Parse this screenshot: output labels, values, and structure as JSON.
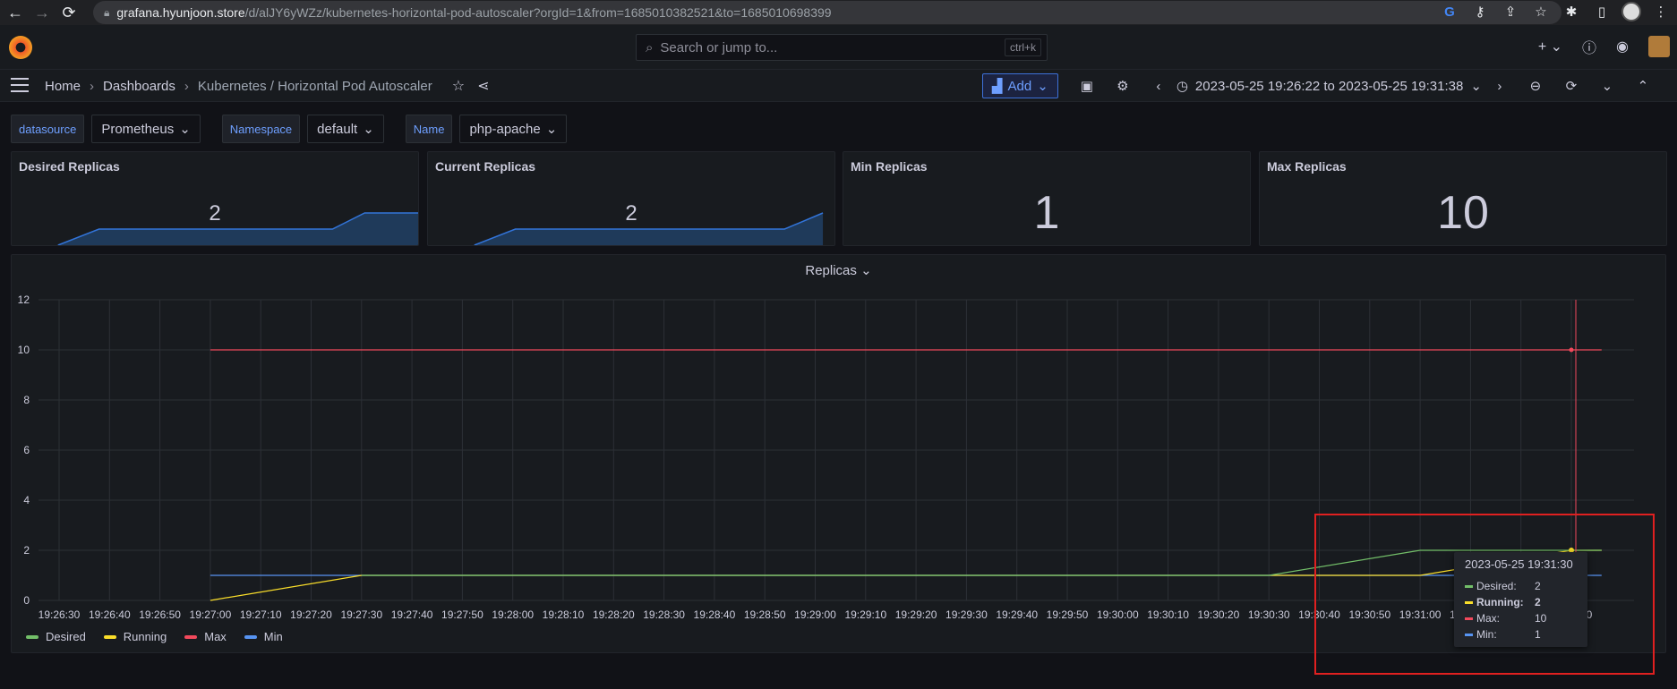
{
  "browser": {
    "url_host": "grafana.hyunjoon.store",
    "url_path": "/d/alJY6yWZz/kubernetes-horizontal-pod-autoscaler?orgId=1&from=1685010382521&to=1685010698399"
  },
  "topbar": {
    "search_placeholder": "Search or jump to...",
    "search_shortcut": "ctrl+k"
  },
  "breadcrumb": {
    "home": "Home",
    "dashboards": "Dashboards",
    "current": "Kubernetes / Horizontal Pod Autoscaler"
  },
  "toolbar": {
    "add_label": "Add",
    "time_range": "2023-05-25 19:26:22 to 2023-05-25 19:31:38"
  },
  "variables": [
    {
      "label": "datasource",
      "value": "Prometheus"
    },
    {
      "label": "Namespace",
      "value": "default"
    },
    {
      "label": "Name",
      "value": "php-apache"
    }
  ],
  "stats": [
    {
      "title": "Desired Replicas",
      "value": "2"
    },
    {
      "title": "Current Replicas",
      "value": "2"
    },
    {
      "title": "Min Replicas",
      "value": "1"
    },
    {
      "title": "Max Replicas",
      "value": "10"
    }
  ],
  "colors": {
    "desired": "#73bf69",
    "running": "#fade2a",
    "max": "#f2495c",
    "min": "#5794f2",
    "spark_fill": "#1f3a5a",
    "spark_line": "#3274d9"
  },
  "chart_data": {
    "type": "line",
    "title": "Replicas",
    "ylim": [
      0,
      12
    ],
    "y_ticks": [
      "0",
      "2",
      "4",
      "6",
      "8",
      "10",
      "12"
    ],
    "x_ticks": [
      "19:26:30",
      "19:26:40",
      "19:26:50",
      "19:27:00",
      "19:27:10",
      "19:27:20",
      "19:27:30",
      "19:27:40",
      "19:27:50",
      "19:28:00",
      "19:28:10",
      "19:28:20",
      "19:28:30",
      "19:28:40",
      "19:28:50",
      "19:29:00",
      "19:29:10",
      "19:29:20",
      "19:29:30",
      "19:29:40",
      "19:29:50",
      "19:30:00",
      "19:30:10",
      "19:30:20",
      "19:30:30",
      "19:30:40",
      "19:30:50",
      "19:31:00",
      "19:31:10",
      "19:31:20",
      "19:31:30"
    ],
    "series": [
      {
        "name": "Desired",
        "x": [
          "19:27:30",
          "19:30:30",
          "19:30:60",
          "19:31:36"
        ],
        "values": [
          1,
          1,
          2,
          2
        ]
      },
      {
        "name": "Running",
        "x": [
          "19:27:00",
          "19:27:30",
          "19:31:00",
          "19:31:30",
          "19:31:36"
        ],
        "values": [
          0,
          1,
          1,
          2,
          2
        ]
      },
      {
        "name": "Max",
        "x": [
          "19:27:00",
          "19:31:36"
        ],
        "values": [
          10,
          10
        ]
      },
      {
        "name": "Min",
        "x": [
          "19:27:00",
          "19:31:36"
        ],
        "values": [
          1,
          1
        ]
      }
    ]
  },
  "tooltip": {
    "time": "2023-05-25 19:31:30",
    "rows": [
      {
        "label": "Desired:",
        "value": "2"
      },
      {
        "label": "Running:",
        "value": "2"
      },
      {
        "label": "Max:",
        "value": "10"
      },
      {
        "label": "Min:",
        "value": "1"
      }
    ]
  },
  "legend": [
    "Desired",
    "Running",
    "Max",
    "Min"
  ]
}
